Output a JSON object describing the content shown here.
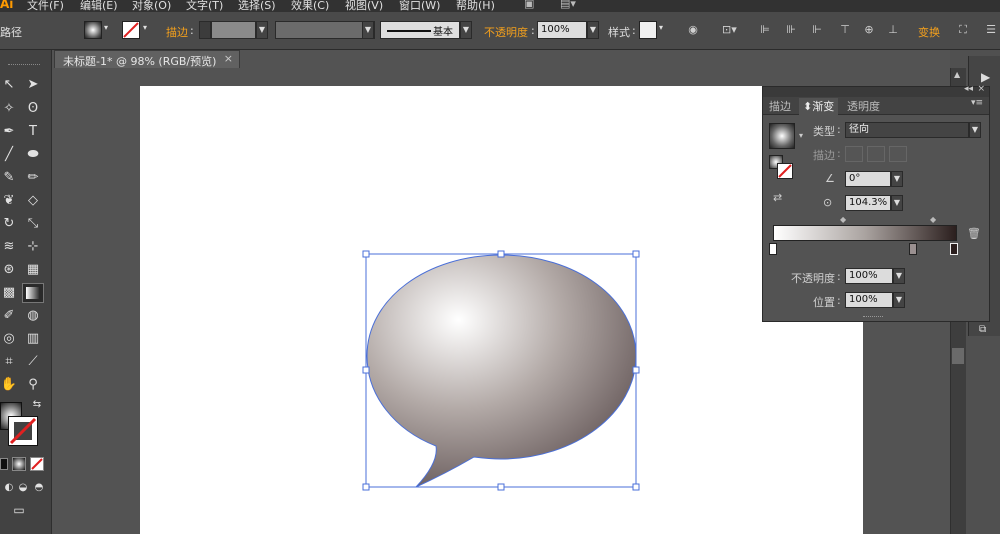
{
  "app": {
    "logo": "Ai"
  },
  "menu": [
    "文件(F)",
    "编辑(E)",
    "对象(O)",
    "文字(T)",
    "选择(S)",
    "效果(C)",
    "视图(V)",
    "窗口(W)",
    "帮助(H)"
  ],
  "controlbar": {
    "tool_name": "路径",
    "stroke_label": "描边",
    "stroke_style": "基本",
    "opacity_label": "不透明度",
    "opacity_value": "100%",
    "style_label": "样式",
    "transform_label": "变换"
  },
  "document": {
    "tab_title": "未标题-1* @ 98% (RGB/预览)",
    "close": "×"
  },
  "gradient_panel": {
    "tabs": [
      "描边",
      "渐变",
      "透明度"
    ],
    "active_tab": "渐变",
    "type_label": "类型",
    "type_value": "径向",
    "stroke_label": "描边",
    "angle_value": "0°",
    "aspect_value": "104.3%",
    "opacity_label": "不透明度",
    "opacity_value": "100%",
    "location_label": "位置",
    "location_value": "100%",
    "gradient_colors": {
      "start": "#ffffff",
      "end": "#2b1f1e"
    }
  },
  "colors": {
    "accent": "#f4a01c",
    "selection": "#4a6fd8"
  },
  "icons": [
    "selection-tool-icon",
    "direct-selection-icon",
    "magic-wand-icon",
    "lasso-icon",
    "pen-icon",
    "type-icon",
    "line-icon",
    "ellipse-icon",
    "brush-icon",
    "pencil-icon",
    "blob-brush-icon",
    "eraser-icon",
    "rotate-icon",
    "scale-icon",
    "warp-icon",
    "free-transform-icon",
    "shape-builder-icon",
    "perspective-icon",
    "mesh-icon",
    "gradient-icon",
    "eyedropper-icon",
    "blend-icon",
    "symbol-sprayer-icon",
    "graph-icon",
    "artboard-icon",
    "slice-icon",
    "hand-icon",
    "zoom-icon",
    "trash-icon"
  ]
}
